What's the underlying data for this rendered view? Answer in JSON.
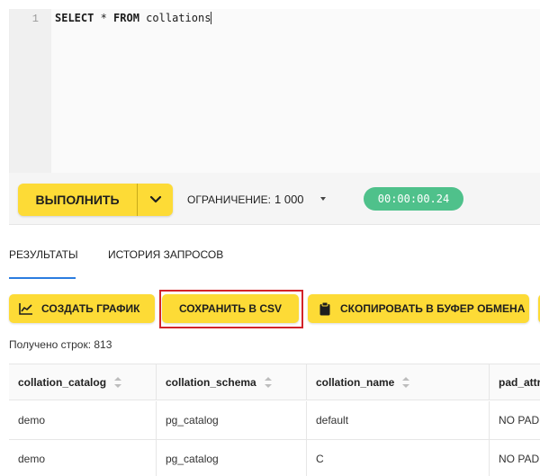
{
  "editor": {
    "line_number": "1",
    "kw_select": "SELECT",
    "star": " * ",
    "kw_from": "FROM",
    "table_name": " collations"
  },
  "toolbar": {
    "run_label": "ВЫПОЛНИТЬ",
    "limit_label": "ОГРАНИЧЕНИЕ:",
    "limit_value": "1 000",
    "timer": "00:00:00.24"
  },
  "tabs": {
    "results": "РЕЗУЛЬТАТЫ",
    "history": "ИСТОРИЯ ЗАПРОСОВ"
  },
  "actions": {
    "create_chart": "СОЗДАТЬ ГРАФИК",
    "save_csv": "СОХРАНИТЬ В CSV",
    "copy_clipboard": "СКОПИРОВАТЬ В БУФЕР ОБМЕНА"
  },
  "results": {
    "rows_received": "Получено строк: 813"
  },
  "table": {
    "columns": [
      "collation_catalog",
      "collation_schema",
      "collation_name",
      "pad_attr"
    ],
    "rows": [
      [
        "demo",
        "pg_catalog",
        "default",
        "NO PAD"
      ],
      [
        "demo",
        "pg_catalog",
        "C",
        "NO PAD"
      ]
    ]
  },
  "colors": {
    "accent": "#fddb36",
    "timer_bg": "#4fc18b",
    "highlight": "#d2232a",
    "tab_underline": "#2b7de0"
  }
}
